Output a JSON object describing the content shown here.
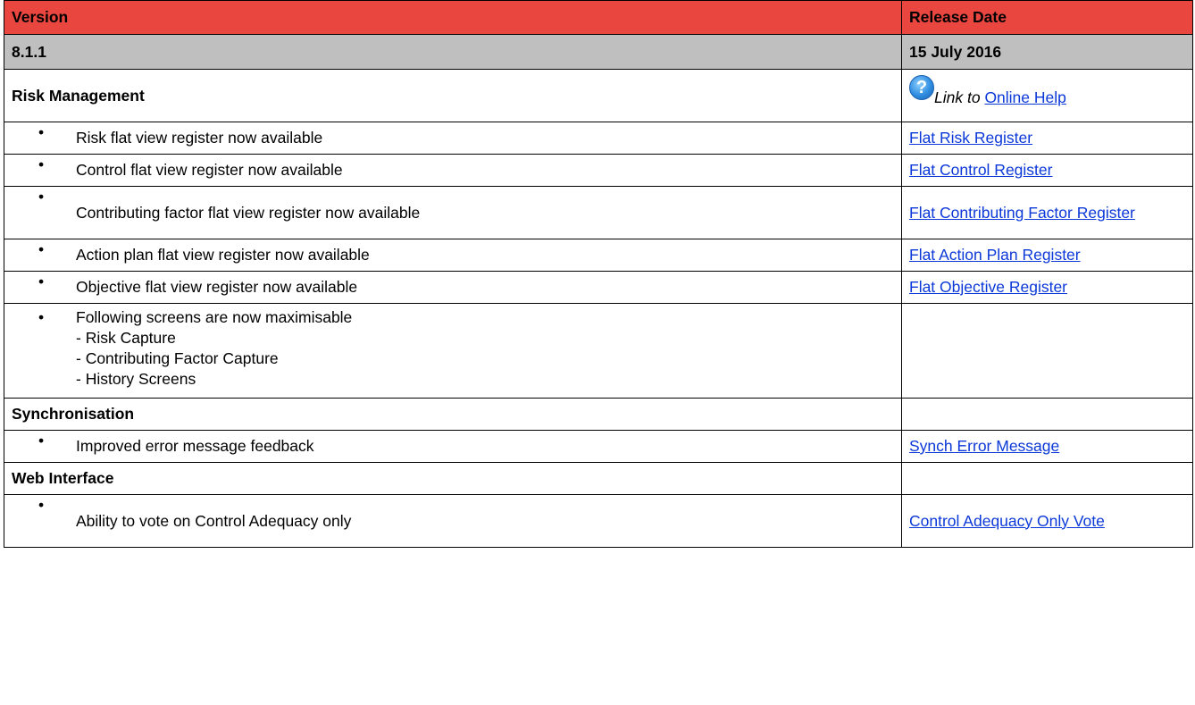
{
  "header": {
    "version_label": "Version",
    "release_date_label": "Release Date"
  },
  "version_row": {
    "version": "8.1.1",
    "date": "15 July 2016"
  },
  "risk_management": {
    "title": "Risk Management",
    "help_icon": "question-mark-icon",
    "link_prefix": "Link to",
    "link_text": "Online Help",
    "items": [
      {
        "text": "Risk flat view register now available",
        "link": "Flat Risk Register"
      },
      {
        "text": "Control flat view register now available",
        "link": "Flat Control Register"
      },
      {
        "text": "Contributing factor flat view register now available",
        "link": "Flat Contributing Factor Register"
      },
      {
        "text": "Action plan flat view register now available",
        "link": "Flat Action Plan Register"
      },
      {
        "text": "Objective flat view register now available",
        "link": "Flat Objective Register"
      }
    ],
    "maximisable": {
      "text": "Following screens are now maximisable",
      "sub_items": [
        "- Risk Capture",
        "- Contributing Factor Capture",
        "- History Screens"
      ]
    }
  },
  "synchronisation": {
    "title": "Synchronisation",
    "items": [
      {
        "text": "Improved error message feedback",
        "link": "Synch Error Message"
      }
    ]
  },
  "web_interface": {
    "title": "Web Interface",
    "items": [
      {
        "text": "Ability to vote on Control Adequacy only",
        "link": "Control Adequacy Only Vote"
      }
    ]
  },
  "colors": {
    "header_bg": "#e94640",
    "version_bg": "#bfbfbf",
    "link": "#0b38d8"
  },
  "bullet": "•"
}
